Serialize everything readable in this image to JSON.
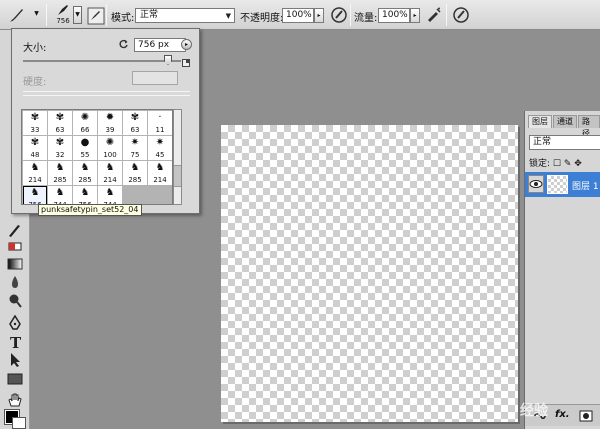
{
  "options_bar": {
    "brush_preset_size": "756",
    "mode_label": "模式:",
    "mode_value": "正常",
    "opacity_label": "不透明度:",
    "opacity_value": "100%",
    "flow_label": "流量:",
    "flow_value": "100%"
  },
  "brush_picker": {
    "size_label": "大小:",
    "size_value": "756 px",
    "hardness_label": "硬度:",
    "slider_value": 0.95,
    "brushes": [
      {
        "size": "33",
        "glyph": "✾"
      },
      {
        "size": "63",
        "glyph": "✾"
      },
      {
        "size": "66",
        "glyph": "✺"
      },
      {
        "size": "39",
        "glyph": "✹"
      },
      {
        "size": "63",
        "glyph": "✾"
      },
      {
        "size": "11",
        "glyph": "·"
      },
      {
        "size": "48",
        "glyph": "✾"
      },
      {
        "size": "32",
        "glyph": "✾"
      },
      {
        "size": "55",
        "glyph": "●"
      },
      {
        "size": "100",
        "glyph": "✺"
      },
      {
        "size": "75",
        "glyph": "✷"
      },
      {
        "size": "45",
        "glyph": "✷"
      },
      {
        "size": "214",
        "glyph": "♞"
      },
      {
        "size": "285",
        "glyph": "♞"
      },
      {
        "size": "285",
        "glyph": "♞"
      },
      {
        "size": "214",
        "glyph": "♞"
      },
      {
        "size": "285",
        "glyph": "♞"
      },
      {
        "size": "214",
        "glyph": "♞"
      },
      {
        "size": "756",
        "glyph": "♞",
        "selected": true
      },
      {
        "size": "744",
        "glyph": "♞"
      },
      {
        "size": "756",
        "glyph": "♞"
      },
      {
        "size": "744",
        "glyph": "♞"
      }
    ],
    "tooltip": "punksafetypin_set52_04"
  },
  "layers_panel": {
    "tabs": [
      "图层",
      "通道",
      "路径"
    ],
    "blend_mode": "正常",
    "lock_label": "锁定:",
    "layer_name": "图层 1",
    "fx_label": "fx."
  },
  "watermark": "经验"
}
